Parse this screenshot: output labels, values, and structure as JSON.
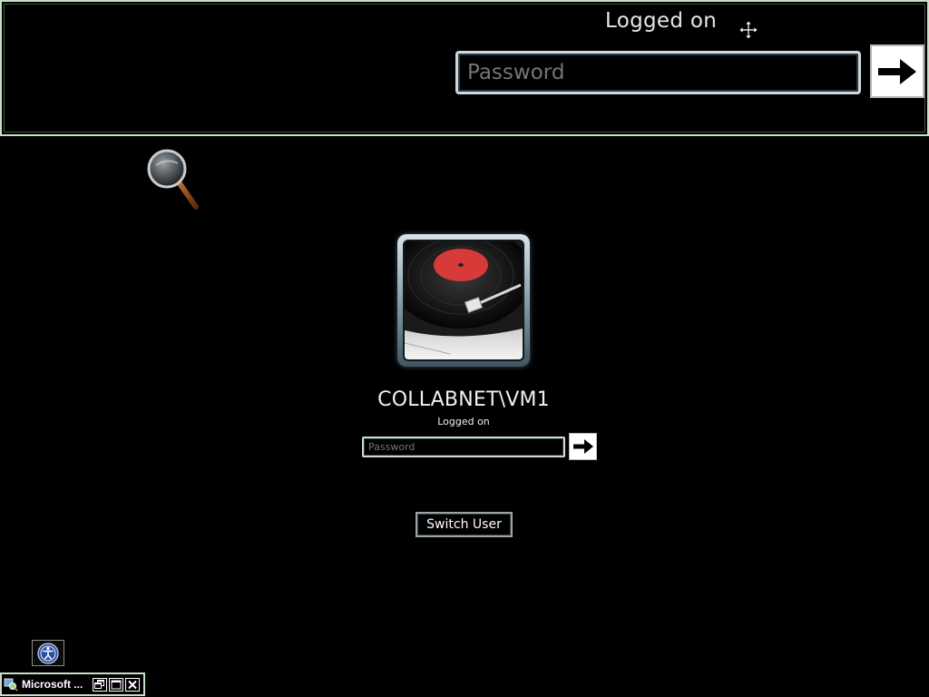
{
  "magnifier_view": {
    "status_text": "Logged on",
    "password_placeholder": "Password",
    "submit_icon": "arrow-right-icon",
    "cursor_icon": "move-cursor-icon"
  },
  "magnifier_lens": {
    "icon": "magnifier-lens-icon"
  },
  "login": {
    "user_tile_icon": "turntable-record-picture",
    "user_name": "COLLABNET\\VM1",
    "status_text": "Logged on",
    "password_placeholder": "Password",
    "submit_icon": "arrow-right-icon",
    "switch_user_label": "Switch User"
  },
  "ease_of_access": {
    "icon": "ease-of-access-icon"
  },
  "minimized_window": {
    "title": "Microsoft ...",
    "app_icon": "magnifier-app-icon",
    "buttons": [
      "restore",
      "maximize",
      "close"
    ]
  },
  "colors": {
    "background": "#000000",
    "password_text": "#2ecc40",
    "window_border": "#c6e0c6"
  }
}
